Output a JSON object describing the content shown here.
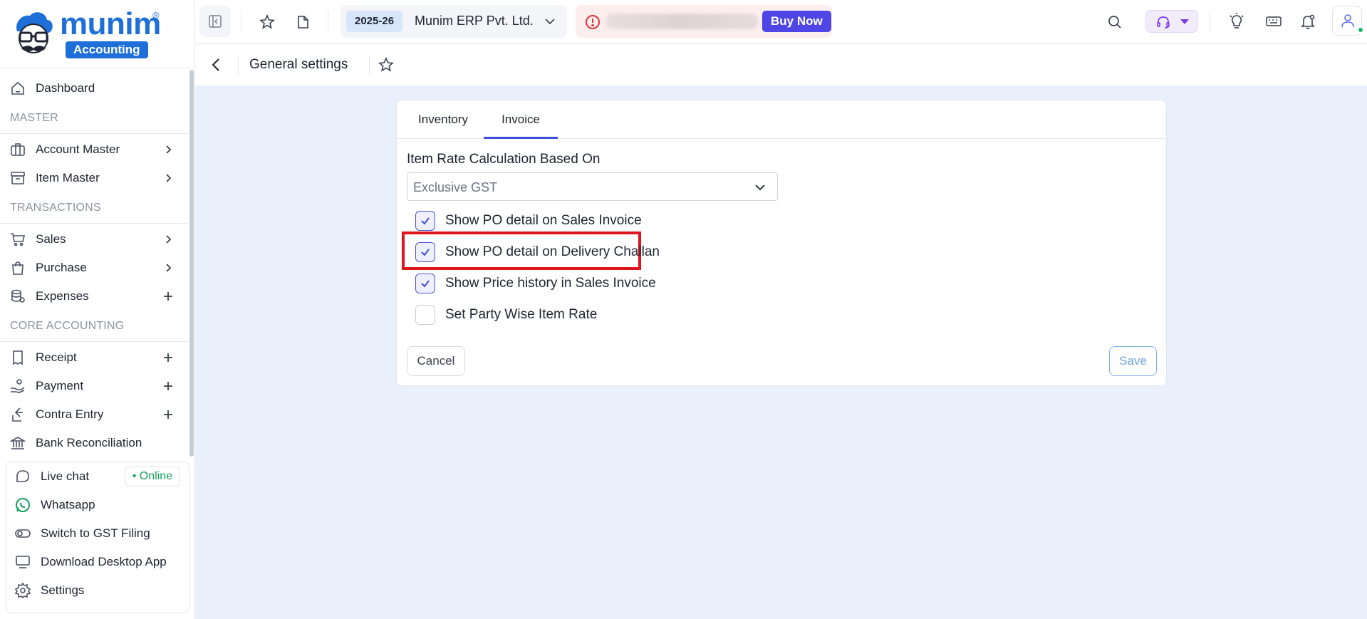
{
  "brand": {
    "name": "munim",
    "badge": "Accounting",
    "reg": "®"
  },
  "sidebar": {
    "items": [
      {
        "label": "Dashboard",
        "icon": "home-icon"
      },
      {
        "section": "MASTER"
      },
      {
        "label": "Account Master",
        "icon": "briefcase-icon",
        "trail": "chevron-right-icon"
      },
      {
        "label": "Item Master",
        "icon": "archive-icon",
        "trail": "chevron-right-icon"
      },
      {
        "section": "TRANSACTIONS"
      },
      {
        "label": "Sales",
        "icon": "cart-icon",
        "trail": "chevron-right-icon"
      },
      {
        "label": "Purchase",
        "icon": "bag-icon",
        "trail": "chevron-right-icon"
      },
      {
        "label": "Expenses",
        "icon": "database-icon",
        "trail": "plus-icon"
      },
      {
        "section": "CORE ACCOUNTING"
      },
      {
        "label": "Receipt",
        "icon": "receipt-icon",
        "trail": "plus-icon"
      },
      {
        "label": "Payment",
        "icon": "hand-coin-icon",
        "trail": "plus-icon"
      },
      {
        "label": "Contra Entry",
        "icon": "exchange-icon",
        "trail": "plus-icon"
      },
      {
        "label": "Bank Reconciliation",
        "icon": "bank-icon"
      }
    ],
    "help": [
      {
        "label": "Live chat",
        "icon": "chat-icon",
        "badge": "• Online"
      },
      {
        "label": "Whatsapp",
        "icon": "whatsapp-icon"
      },
      {
        "label": "Switch to GST Filing",
        "icon": "toggle-icon"
      },
      {
        "label": "Download Desktop App",
        "icon": "monitor-icon"
      },
      {
        "label": "Settings",
        "icon": "gear-icon"
      }
    ]
  },
  "topbar": {
    "financial_year": "2025-26",
    "company": "Munim ERP Pvt. Ltd.",
    "buy_now": "Buy Now"
  },
  "page": {
    "title": "General settings"
  },
  "tabs": [
    {
      "label": "Inventory",
      "active": false
    },
    {
      "label": "Invoice",
      "active": true
    }
  ],
  "form": {
    "rate_label": "Item Rate Calculation Based On",
    "rate_value": "Exclusive GST",
    "options": [
      {
        "label": "Show PO detail on Sales Invoice",
        "checked": true
      },
      {
        "label": "Show PO detail on Delivery Challan",
        "checked": true,
        "highlighted": true
      },
      {
        "label": "Show Price history in Sales Invoice",
        "checked": true
      },
      {
        "label": "Set Party Wise Item Rate",
        "checked": false
      }
    ],
    "cancel": "Cancel",
    "save": "Save"
  },
  "colors": {
    "brand": "#1f6fd9",
    "accent": "#4f46e5",
    "tab_underline": "#3f4ed8",
    "highlight": "#e0141c",
    "online": "#13a05a",
    "page_bg": "#eaf0fb"
  }
}
